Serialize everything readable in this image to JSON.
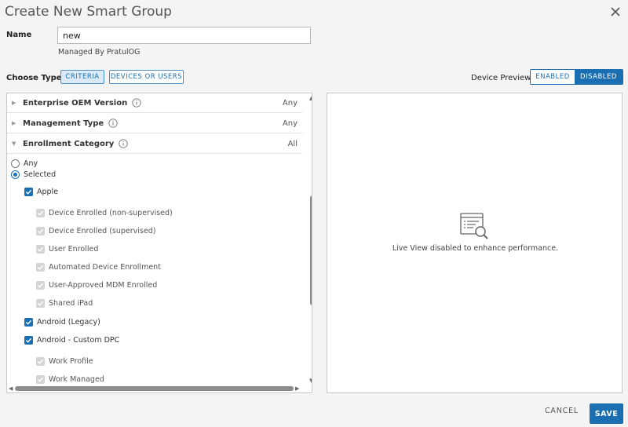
{
  "dialog": {
    "title": "Create New Smart Group"
  },
  "name_field": {
    "label": "Name",
    "value": "new",
    "managed_by": "Managed By PratulOG"
  },
  "choose_type": {
    "label": "Choose Type",
    "criteria": "CRITERIA",
    "devices_or_users": "DEVICES OR USERS"
  },
  "device_preview": {
    "label": "Device Preview",
    "enabled": "ENABLED",
    "disabled": "DISABLED"
  },
  "criteria_list": {
    "headers": [
      {
        "label": "Enterprise OEM Version",
        "value": "Any"
      },
      {
        "label": "Management Type",
        "value": "Any"
      },
      {
        "label": "Enrollment Category",
        "value": "All"
      }
    ],
    "radio": {
      "any": "Any",
      "selected": "Selected"
    },
    "apple": {
      "label": "Apple",
      "children": [
        "Device Enrolled (non-supervised)",
        "Device Enrolled (supervised)",
        "User Enrolled",
        "Automated Device Enrollment",
        "User-Approved MDM Enrolled",
        "Shared iPad"
      ]
    },
    "android_legacy": "Android (Legacy)",
    "android_custom": {
      "label": "Android - Custom DPC",
      "children": [
        "Work Profile",
        "Work Managed"
      ]
    }
  },
  "preview_panel": {
    "message": "Live View disabled to enhance performance."
  },
  "footer": {
    "cancel": "CANCEL",
    "save": "SAVE"
  },
  "colors": {
    "accent": "#1a6fb3"
  }
}
